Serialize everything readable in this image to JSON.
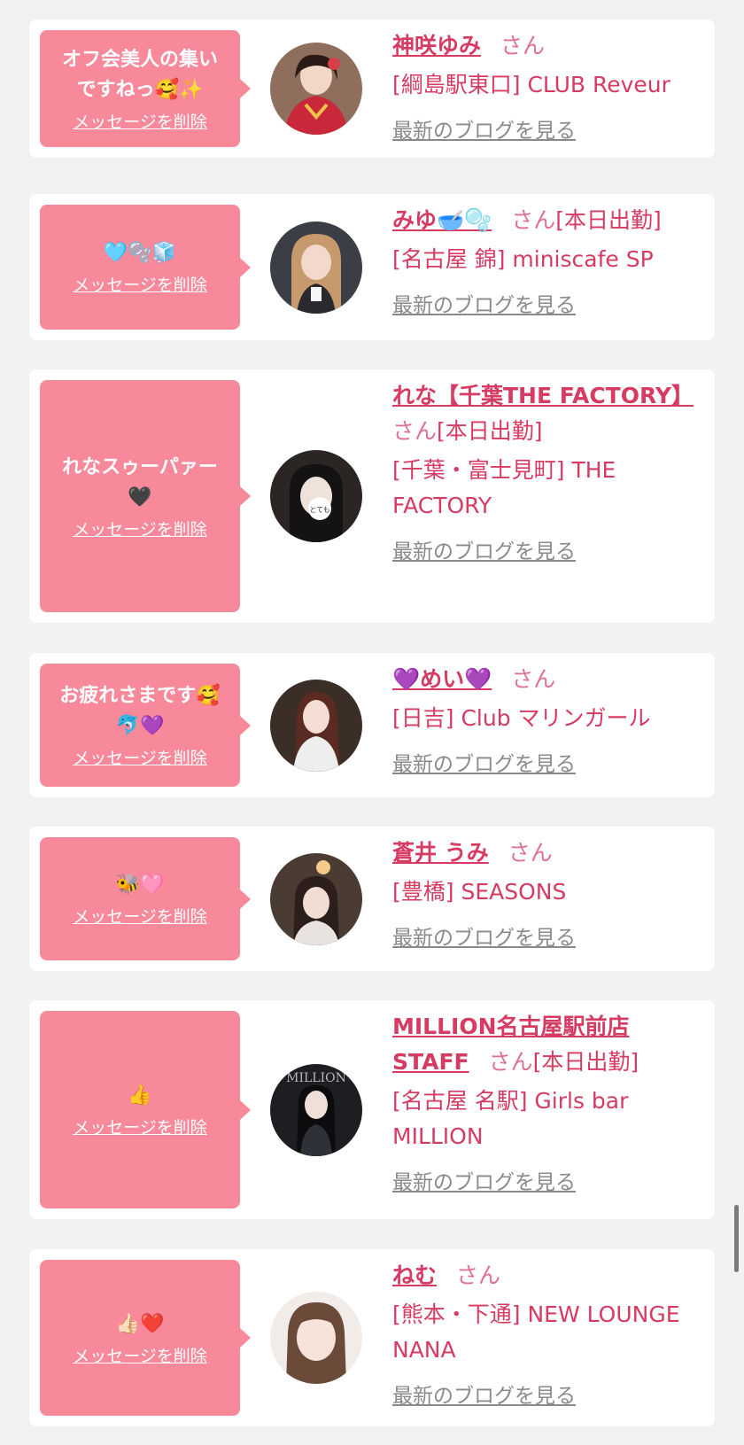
{
  "common": {
    "delete_label": "メッセージを削除",
    "blog_label": "最新のブログを見る",
    "san_label": "さん",
    "working_today_label": "[本日出勤]"
  },
  "colors": {
    "page_bg": "#f2f2f2",
    "card_bg": "#ffffff",
    "bubble_bg": "#f7899b",
    "name_color": "#d63b62",
    "blog_link_color": "#8a8a8a"
  },
  "cards": [
    {
      "message": "オフ会美人の集い\nですねっ🥰✨",
      "name": "神咲ゆみ",
      "working_today": "",
      "shop": "[綱島駅東口] CLUB Reveur",
      "avatar_icon": "avatar-photo-icon"
    },
    {
      "message": "🩵🫧🧊",
      "name": "みゆ🥣🫧",
      "working_today": "[本日出勤]",
      "shop": "[名古屋 錦] miniscafe SP",
      "avatar_icon": "avatar-photo-icon"
    },
    {
      "message": "れなスゥーパァー\n🖤",
      "name": "れな【千葉THE FACTORY】",
      "working_today": "[本日出勤]",
      "shop": "[千葉・富士見町] THE FACTORY",
      "avatar_icon": "avatar-photo-icon"
    },
    {
      "message": "お疲れさまです🥰\n🐬💜",
      "name": "💜めい💜",
      "working_today": "",
      "shop": "[日吉] Club マリンガール",
      "avatar_icon": "avatar-photo-icon"
    },
    {
      "message": "🐝🩷",
      "name": "蒼井 うみ",
      "working_today": "",
      "shop": "[豊橋] SEASONS",
      "avatar_icon": "avatar-photo-icon"
    },
    {
      "message": "👍",
      "name": "MILLION名古屋駅前店STAFF",
      "working_today": "[本日出勤]",
      "shop": "[名古屋 名駅] Girls bar MILLION",
      "avatar_icon": "avatar-photo-icon"
    },
    {
      "message": "👍🏻❤️",
      "name": "ねむ",
      "working_today": "",
      "shop": "[熊本・下通] NEW LOUNGE NANA",
      "avatar_icon": "avatar-photo-icon"
    }
  ]
}
